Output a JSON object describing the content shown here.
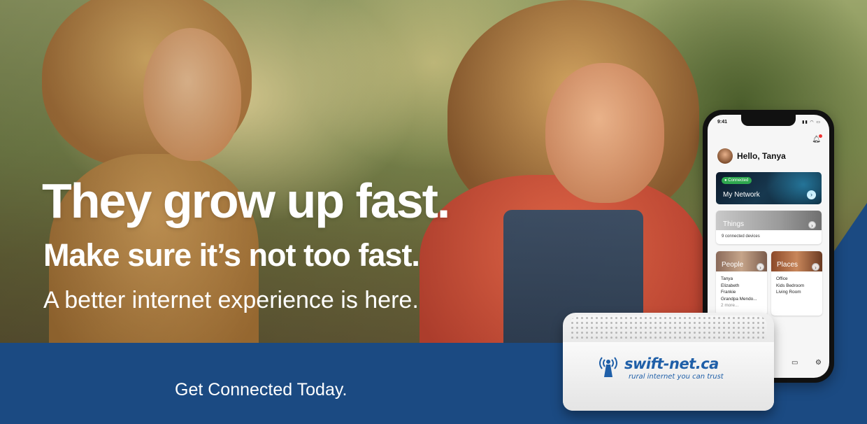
{
  "hero": {
    "headline": "They grow up fast.",
    "subheadline": "Make sure it’s not too fast.",
    "tagline": "A better internet experience is here.",
    "cta": "Get Connected Today."
  },
  "phone": {
    "time": "9:41",
    "greeting": "Hello, Tanya",
    "network_card": {
      "status": "Connected",
      "label": "My Network"
    },
    "things_card": {
      "label": "Things",
      "subtitle": "9 connected devices"
    },
    "people_card": {
      "label": "People",
      "items": [
        "Tanya",
        "Elizabeth",
        "Frankie",
        "Grandpa Mendo..."
      ],
      "more": "2 more..."
    },
    "places_card": {
      "label": "Places",
      "items": [
        "Office",
        "Kids Bedroom",
        "Living Room"
      ]
    },
    "icons": [
      "bell-icon",
      "chevron-right-icon",
      "router-icon",
      "gear-icon"
    ]
  },
  "router": {
    "brand": "swift-net.ca",
    "slogan": "rural internet you can trust"
  },
  "colors": {
    "band_blue": "#1b4a82",
    "brand_blue": "#1f5fa8",
    "connected_green": "#2fa84f"
  }
}
